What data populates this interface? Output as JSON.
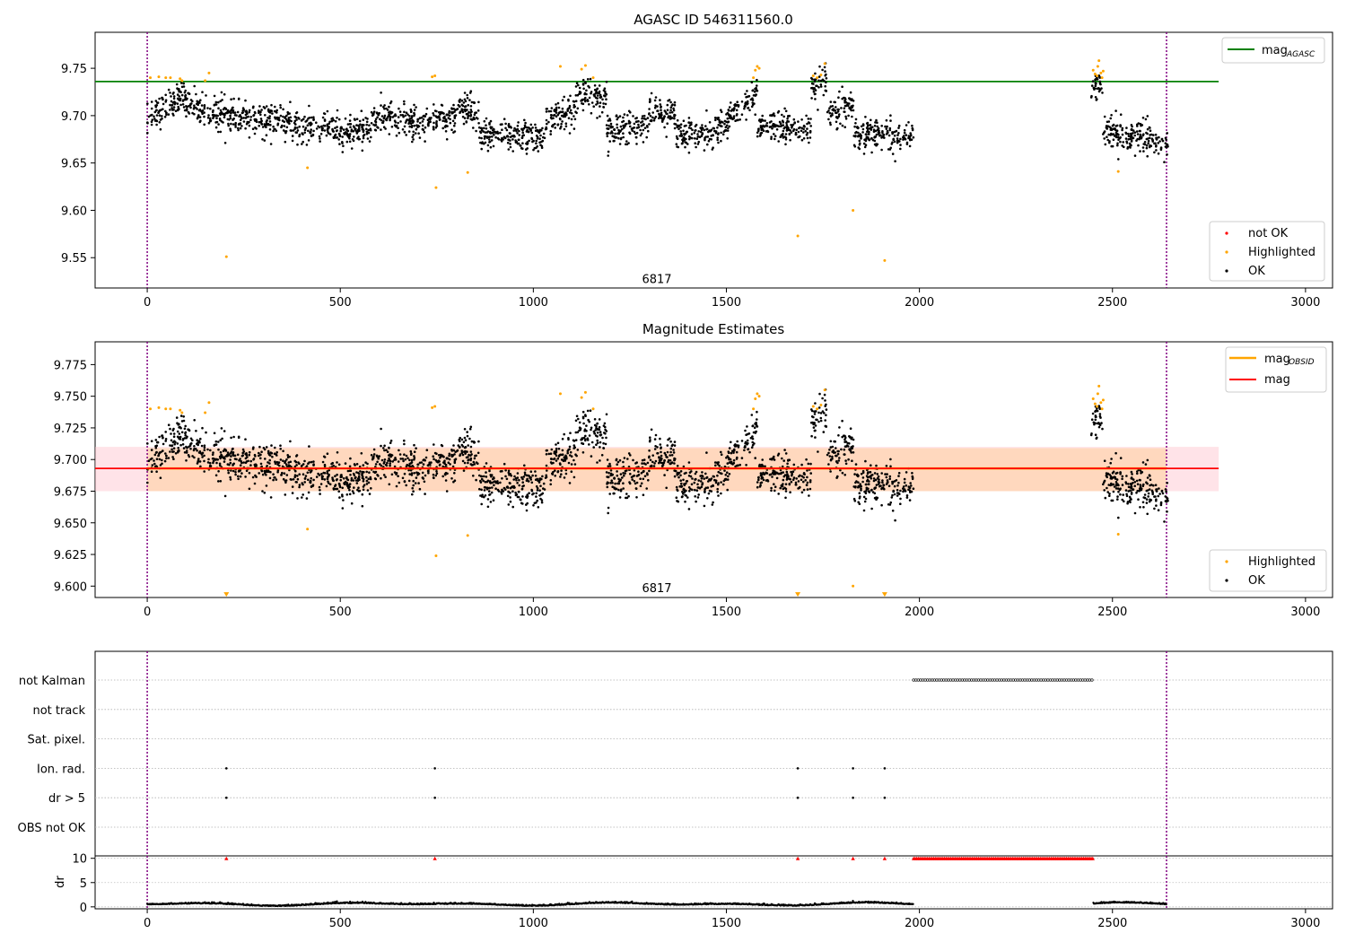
{
  "colors": {
    "ok": "#000000",
    "highlighted": "#ffa500",
    "not_ok": "#ff0000",
    "mag_agasc": "#008000",
    "mag_obsid": "#ffa500",
    "mag": "#ff0000",
    "band_light": "#ffc0cb",
    "band_orange": "#ffa500",
    "limit_line": "#800080"
  },
  "chart_data": [
    {
      "type": "scatter",
      "title": "AGASC ID 546311560.0",
      "xlim": [
        -135,
        3070
      ],
      "ylim": [
        9.518,
        9.788
      ],
      "x_ticks": [
        0,
        500,
        1000,
        1500,
        2000,
        2500,
        3000
      ],
      "y_ticks": [
        9.55,
        9.6,
        9.65,
        9.7,
        9.75
      ],
      "obsid_label": {
        "text": "6817",
        "x": 1320,
        "y": 9.527
      },
      "vlines": [
        0,
        2640
      ],
      "hline": {
        "name": "mag_AGASC",
        "label_main": "mag",
        "label_sub": "AGASC",
        "y": 9.736,
        "xmin": -135,
        "xmax": 2775
      },
      "segments": [
        {
          "x0": 0,
          "x1": 100,
          "y0": 9.695,
          "y1": 9.725
        },
        {
          "x0": 100,
          "x1": 200,
          "y0": 9.712,
          "y1": 9.7
        },
        {
          "x0": 200,
          "x1": 400,
          "y0": 9.7,
          "y1": 9.69
        },
        {
          "x0": 400,
          "x1": 580,
          "y0": 9.685,
          "y1": 9.685
        },
        {
          "x0": 580,
          "x1": 720,
          "y0": 9.7,
          "y1": 9.69
        },
        {
          "x0": 720,
          "x1": 800,
          "y0": 9.695,
          "y1": 9.7
        },
        {
          "x0": 800,
          "x1": 860,
          "y0": 9.708,
          "y1": 9.705
        },
        {
          "x0": 860,
          "x1": 1030,
          "y0": 9.68,
          "y1": 9.675
        },
        {
          "x0": 1030,
          "x1": 1110,
          "y0": 9.695,
          "y1": 9.705
        },
        {
          "x0": 1110,
          "x1": 1190,
          "y0": 9.722,
          "y1": 9.718
        },
        {
          "x0": 1190,
          "x1": 1300,
          "y0": 9.685,
          "y1": 9.69
        },
        {
          "x0": 1300,
          "x1": 1370,
          "y0": 9.705,
          "y1": 9.7
        },
        {
          "x0": 1370,
          "x1": 1500,
          "y0": 9.68,
          "y1": 9.685
        },
        {
          "x0": 1500,
          "x1": 1580,
          "y0": 9.695,
          "y1": 9.722
        },
        {
          "x0": 1580,
          "x1": 1720,
          "y0": 9.688,
          "y1": 9.686
        },
        {
          "x0": 1720,
          "x1": 1760,
          "y0": 9.728,
          "y1": 9.735
        },
        {
          "x0": 1760,
          "x1": 1830,
          "y0": 9.7,
          "y1": 9.708
        },
        {
          "x0": 1830,
          "x1": 1985,
          "y0": 9.682,
          "y1": 9.678
        },
        {
          "x0": 2445,
          "x1": 2475,
          "y0": 9.735,
          "y1": 9.73
        },
        {
          "x0": 2475,
          "x1": 2645,
          "y0": 9.685,
          "y1": 9.672
        }
      ],
      "ok_noise": 0.011,
      "highlighted": [
        [
          8,
          9.74
        ],
        [
          30,
          9.741
        ],
        [
          48,
          9.74
        ],
        [
          60,
          9.74
        ],
        [
          85,
          9.739
        ],
        [
          90,
          9.737
        ],
        [
          150,
          9.737
        ],
        [
          160,
          9.745
        ],
        [
          205,
          9.551
        ],
        [
          415,
          9.645
        ],
        [
          738,
          9.741
        ],
        [
          745,
          9.742
        ],
        [
          748,
          9.624
        ],
        [
          830,
          9.64
        ],
        [
          1070,
          9.752
        ],
        [
          1125,
          9.749
        ],
        [
          1135,
          9.753
        ],
        [
          1155,
          9.74
        ],
        [
          1570,
          9.74
        ],
        [
          1575,
          9.748
        ],
        [
          1580,
          9.752
        ],
        [
          1585,
          9.75
        ],
        [
          1685,
          9.573
        ],
        [
          1725,
          9.742
        ],
        [
          1735,
          9.74
        ],
        [
          1745,
          9.743
        ],
        [
          1755,
          9.755
        ],
        [
          1828,
          9.6
        ],
        [
          1910,
          9.547
        ],
        [
          2450,
          9.748
        ],
        [
          2455,
          9.744
        ],
        [
          2460,
          9.742
        ],
        [
          2462,
          9.752
        ],
        [
          2465,
          9.758
        ],
        [
          2470,
          9.745
        ],
        [
          2473,
          9.74
        ],
        [
          2476,
          9.747
        ],
        [
          2515,
          9.641
        ]
      ],
      "legend": [
        {
          "label": "not OK",
          "color": "#ff0000"
        },
        {
          "label": "Highlighted",
          "color": "#ffa500"
        },
        {
          "label": "OK",
          "color": "#000000"
        }
      ]
    },
    {
      "type": "scatter",
      "title": "Magnitude Estimates",
      "xlim": [
        -135,
        3070
      ],
      "ylim": [
        9.591,
        9.793
      ],
      "x_ticks": [
        0,
        500,
        1000,
        1500,
        2000,
        2500,
        3000
      ],
      "y_ticks": [
        9.6,
        9.625,
        9.65,
        9.675,
        9.7,
        9.725,
        9.75,
        9.775
      ],
      "obsid_label": {
        "text": "6817",
        "x": 1320,
        "y": 9.598
      },
      "vlines": [
        0,
        2640
      ],
      "mag_line": {
        "label": "mag",
        "y": 9.693,
        "xmin": -135,
        "xmax": 2775
      },
      "mag_band": {
        "y0": 9.675,
        "y1": 9.71,
        "xmin": -135,
        "xmax": 2775
      },
      "mag_obsid": {
        "label_main": "mag",
        "label_sub": "OBSID",
        "y": 9.693,
        "band_y0": 9.675,
        "band_y1": 9.709,
        "xmin": 0,
        "xmax": 2640
      },
      "clipped_markers": [
        [
          205,
          9.593
        ],
        [
          1685,
          9.593
        ],
        [
          1910,
          9.593
        ]
      ],
      "legend": [
        {
          "label": "Highlighted",
          "color": "#ffa500"
        },
        {
          "label": "OK",
          "color": "#000000"
        }
      ],
      "legend_lines": [
        {
          "label_main": "mag",
          "label_sub": "OBSID",
          "color": "#ffa500"
        },
        {
          "label_main": "mag",
          "label_sub": "",
          "color": "#ff0000"
        }
      ]
    },
    {
      "type": "scatter",
      "title": "",
      "xlim": [
        -135,
        3070
      ],
      "x_ticks": [
        0,
        500,
        1000,
        1500,
        2000,
        2500,
        3000
      ],
      "vlines": [
        0,
        2640
      ],
      "flag_rows": [
        "not Kalman",
        "not track",
        "Sat. pixel.",
        "Ion. rad.",
        "dr > 5",
        "OBS not OK"
      ],
      "flags": {
        "not Kalman": {
          "range": [
            1985,
            2450
          ]
        },
        "Ion. rad.": {
          "points": [
            205,
            745,
            1685,
            1828,
            1910
          ]
        },
        "dr > 5": {
          "points": [
            205,
            745,
            1685,
            1828,
            1910
          ]
        }
      },
      "dr": {
        "ylabel": "dr",
        "y_ticks": [
          0,
          5,
          10
        ],
        "ylim": [
          -0.4,
          10.5
        ],
        "capped_points": [
          205,
          745,
          1685,
          1828,
          1910
        ],
        "capped_range": [
          1985,
          2450
        ],
        "gap": [
          1985,
          2450
        ]
      }
    }
  ]
}
